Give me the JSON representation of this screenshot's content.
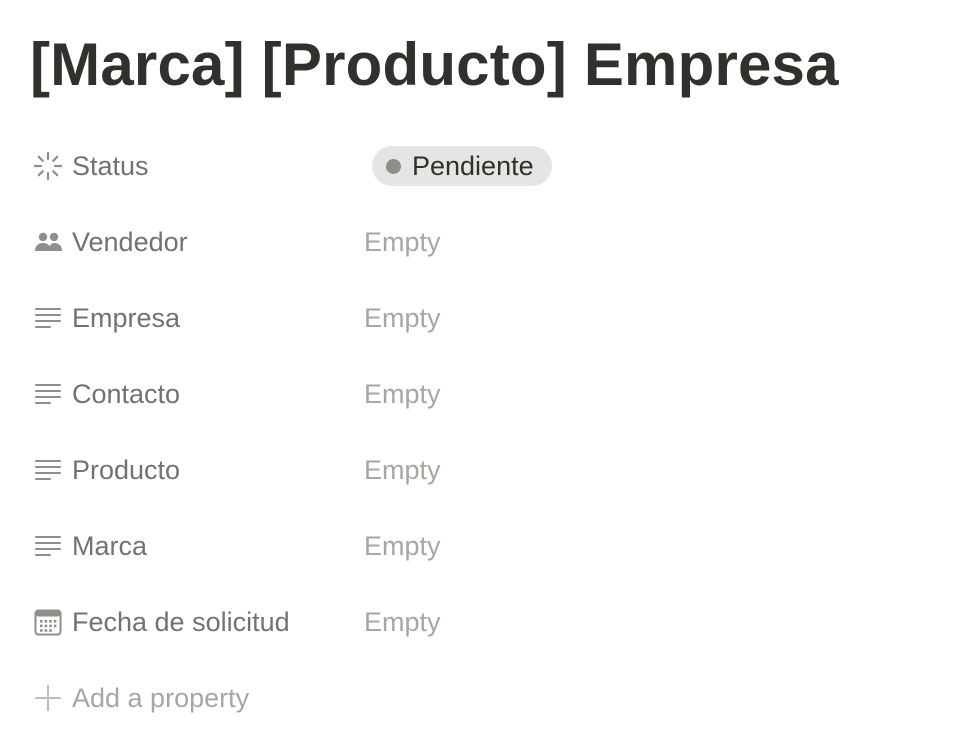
{
  "page": {
    "title": "[Marca] [Producto] Empresa"
  },
  "properties": [
    {
      "name": "Status",
      "icon": "status-icon",
      "type": "status",
      "value": "Pendiente"
    },
    {
      "name": "Vendedor",
      "icon": "people-icon",
      "type": "person",
      "value": "Empty"
    },
    {
      "name": "Empresa",
      "icon": "text-icon",
      "type": "text",
      "value": "Empty"
    },
    {
      "name": "Contacto",
      "icon": "text-icon",
      "type": "text",
      "value": "Empty"
    },
    {
      "name": "Producto",
      "icon": "text-icon",
      "type": "text",
      "value": "Empty"
    },
    {
      "name": "Marca",
      "icon": "text-icon",
      "type": "text",
      "value": "Empty"
    },
    {
      "name": "Fecha de solicitud",
      "icon": "calendar-icon",
      "type": "date",
      "value": "Empty"
    }
  ],
  "add_property": {
    "label": "Add a property",
    "icon": "plus-icon"
  },
  "colors": {
    "title": "#32302c",
    "label": "#73726e",
    "empty": "#a8a6a1",
    "status_pill": "#e6e5e3",
    "status_dot": "#8f8e8b"
  }
}
